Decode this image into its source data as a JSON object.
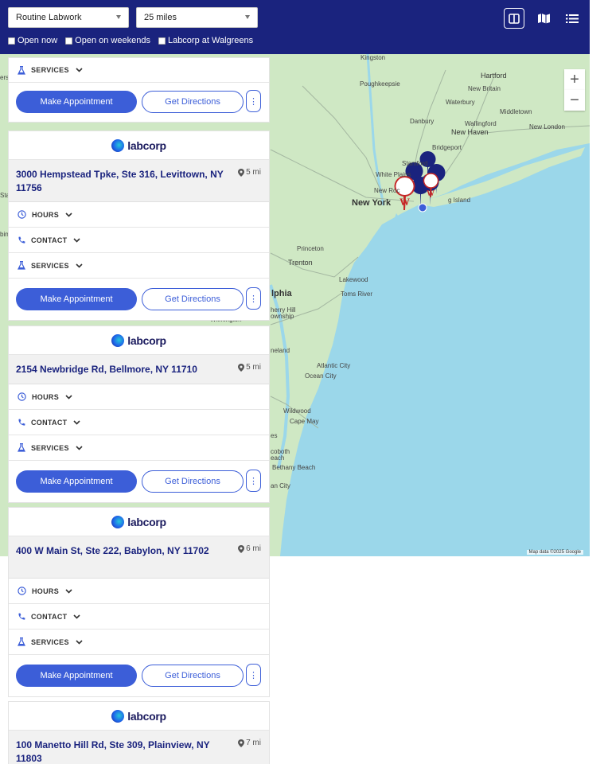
{
  "filters": {
    "test_type": "Routine Labwork",
    "radius": "25 miles",
    "open_now": "Open now",
    "open_weekends": "Open on weekends",
    "walgreens": "Labcorp at Walgreens"
  },
  "map": {
    "zoom_in": "+",
    "zoom_out": "−",
    "attribution": "Map data ©2025 Google",
    "labels": {
      "kingston": "Kingston",
      "hartford": "Hartford",
      "poughkeepsie": "Poughkeepsie",
      "new_britain": "New Britain",
      "waterbury": "Waterbury",
      "middletown": "Middletown",
      "danbury": "Danbury",
      "wallingford": "Wallingford",
      "new_haven": "New Haven",
      "new_london": "New London",
      "bridgeport": "Bridgeport",
      "stamford": "Stamford",
      "white_plains": "White Plains",
      "new_york": "New York",
      "new_roc": "New Roc",
      "long_island": "g Island",
      "princeton": "Princeton",
      "trenton": "Trenton",
      "lakewood": "Lakewood",
      "toms_river": "Toms River",
      "philadelphia": "lphia",
      "cherry_hill": "herry Hill",
      "township": "ownship",
      "wilmington": "Wilmington",
      "vineland": "neland",
      "atlantic_city": "Atlantic City",
      "ocean_city": "Ocean City",
      "wildwood": "Wildwood",
      "cape_may": "Cape May",
      "rehoboth": "coboth",
      "beach": "each",
      "bethany": "Bethany Beach",
      "ocean_city_md": "an City",
      "es": "es",
      "sta": "Sta",
      "ers": "ers",
      "bing": "bing"
    }
  },
  "cards": [
    {
      "services": "SERVICES",
      "make_appointment": "Make Appointment",
      "get_directions": "Get Directions",
      "more": "⋮"
    },
    {
      "logo": "labcorp",
      "address": "3000 Hempstead Tpke, Ste 316, Levittown, NY 11756",
      "distance": "5 mi",
      "hours": "HOURS",
      "contact": "CONTACT",
      "services": "SERVICES",
      "make_appointment": "Make Appointment",
      "get_directions": "Get Directions",
      "more": "⋮"
    },
    {
      "logo": "labcorp",
      "address": "2154 Newbridge Rd, Bellmore, NY 11710",
      "distance": "5 mi",
      "hours": "HOURS",
      "contact": "CONTACT",
      "services": "SERVICES",
      "make_appointment": "Make Appointment",
      "get_directions": "Get Directions",
      "more": "⋮"
    },
    {
      "logo": "labcorp",
      "address": "400 W Main St, Ste 222, Babylon, NY 11702",
      "distance": "6 mi",
      "hours": "HOURS",
      "contact": "CONTACT",
      "services": "SERVICES",
      "make_appointment": "Make Appointment",
      "get_directions": "Get Directions",
      "more": "⋮"
    },
    {
      "logo": "labcorp",
      "address": "100 Manetto Hill Rd, Ste 309, Plainview, NY 11803",
      "distance": "7 mi"
    }
  ],
  "colors": {
    "header": "#1a237e",
    "primary_button": "#3c5ed8",
    "address_text": "#1a237e",
    "water": "#9bd7ea",
    "land": "#cfe8c4"
  }
}
